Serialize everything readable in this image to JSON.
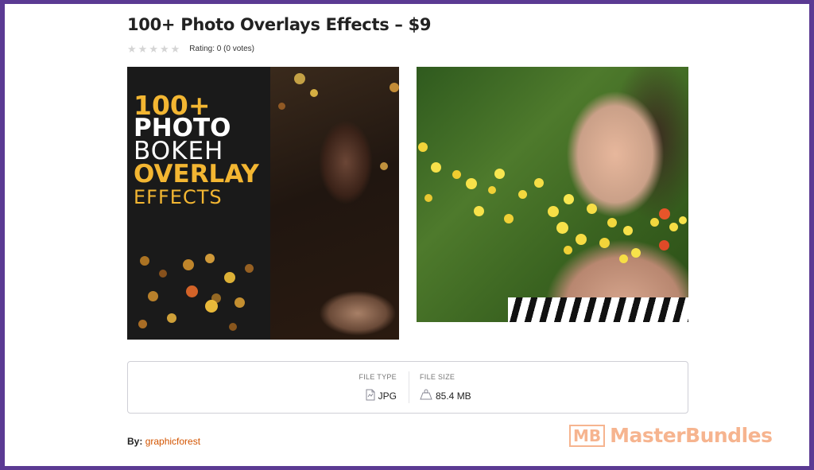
{
  "product": {
    "title": "100+ Photo Overlays Effects – $9",
    "rating_text": "Rating: 0 (0 votes)",
    "stars": 0
  },
  "preview_left": {
    "line1": "100+",
    "line2": "PHOTO",
    "line3": "BOKEH",
    "line4": "OVERLAY",
    "line5": "EFFECTS"
  },
  "file_info": {
    "type_label": "FILE TYPE",
    "type_value": "JPG",
    "size_label": "FILE SIZE",
    "size_value": "85.4 MB",
    "type_icon": "file-icon",
    "size_icon": "weight-icon"
  },
  "author": {
    "by_label": "By:",
    "name": "graphicforest"
  },
  "watermark": {
    "logo": "MB",
    "text": "MasterBundles"
  },
  "colors": {
    "frame": "#5b3a93",
    "accent_gold": "#f3b632",
    "link": "#d35400",
    "watermark": "#f5a87c"
  }
}
